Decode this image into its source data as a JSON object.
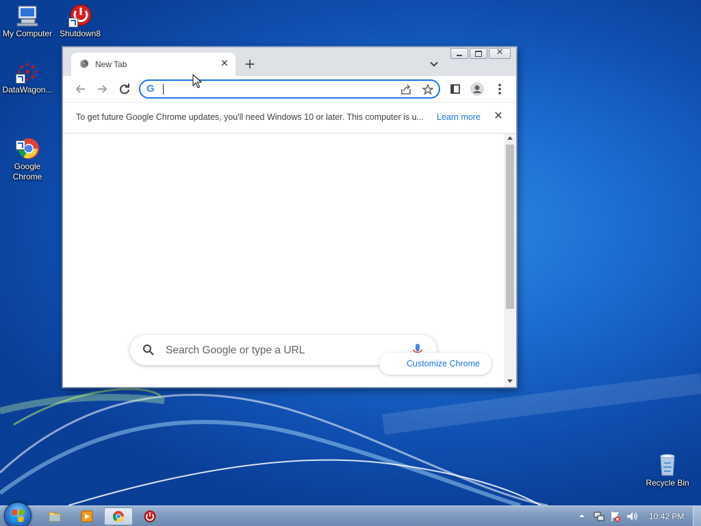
{
  "desktop": {
    "icons": [
      {
        "label": "My Computer",
        "icon": "computer-icon"
      },
      {
        "label": "Shutdown8",
        "icon": "power-icon"
      },
      {
        "label": "DataWagon...",
        "icon": "datawagon-icon"
      },
      {
        "label": "Google\nChrome",
        "icon": "chrome-icon"
      },
      {
        "label": "Recycle Bin",
        "icon": "recycle-bin-icon"
      }
    ]
  },
  "browser": {
    "tab": {
      "title": "New Tab"
    },
    "omnibox": {
      "value": ""
    },
    "infobar": {
      "message": "To get future Google Chrome updates, you'll need Windows 10 or later. This computer is u...",
      "link": "Learn more"
    },
    "ntp": {
      "search_placeholder": "Search Google or type a URL",
      "customize_label": "Customize Chrome"
    }
  },
  "taskbar": {
    "items": [
      "windows-explorer",
      "media-player",
      "google-chrome",
      "shutdown8"
    ],
    "active_item": "google-chrome",
    "clock": "10:42 PM"
  },
  "colors": {
    "accent": "#1a73e8",
    "desktop_blue": "#1c6cd0",
    "tab_strip": "#dee1e6"
  }
}
